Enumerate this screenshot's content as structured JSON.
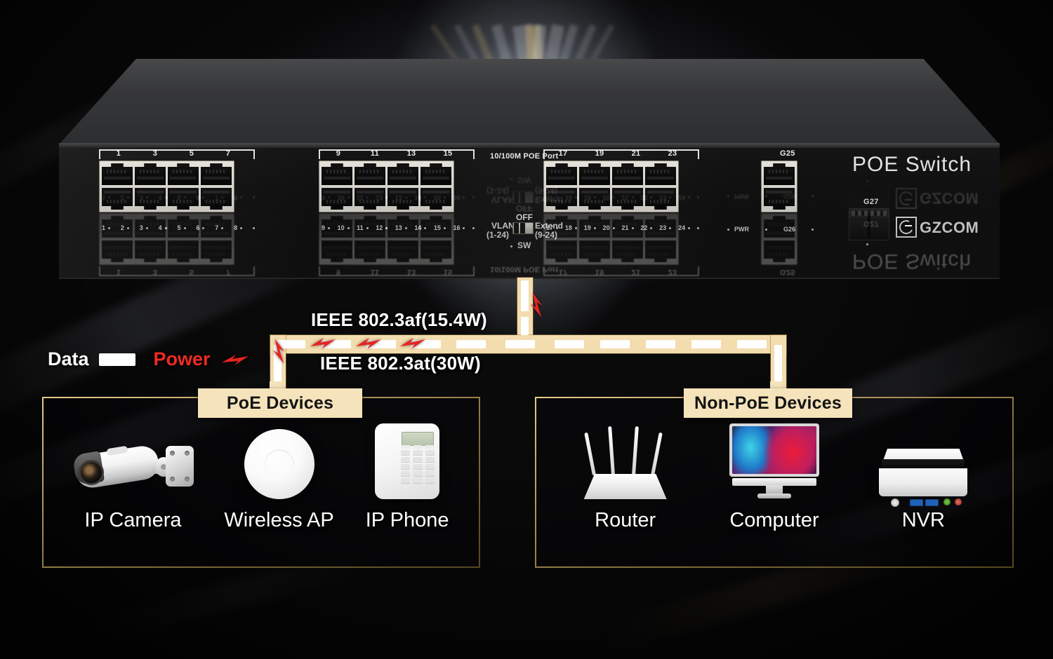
{
  "device": {
    "brand": "GZCOM",
    "model_label": "POE Switch",
    "port_group_label": "10/100M POE  Port",
    "port_groups": [
      {
        "bracket_numbers": [
          "1",
          "3",
          "5",
          "7"
        ],
        "led_labels": [
          "1",
          "2",
          "3",
          "4",
          "5",
          "6",
          "7",
          "8"
        ]
      },
      {
        "bracket_numbers": [
          "9",
          "11",
          "13",
          "15"
        ],
        "led_labels": [
          "9",
          "10",
          "11",
          "12",
          "13",
          "14",
          "15",
          "16"
        ]
      },
      {
        "bracket_numbers": [
          "17",
          "19",
          "21",
          "23"
        ],
        "led_labels": [
          "17",
          "18",
          "19",
          "20",
          "21",
          "22",
          "23",
          "24"
        ]
      }
    ],
    "uplink": {
      "top_label": "G25",
      "bottom_label": "G26",
      "sfp_label": "G27"
    },
    "power_led_label": "PWR",
    "dip_switch": {
      "left_line1": "VLAN",
      "left_line2": "(1-24)",
      "top_label": "OFF",
      "right_line1": "Extend",
      "right_line2": "(9-24)",
      "bottom_label": "SW"
    }
  },
  "legend": {
    "data_label": "Data",
    "power_label": "Power"
  },
  "standards": {
    "af": "IEEE 802.3af(15.4W)",
    "at": "IEEE 802.3at(30W)"
  },
  "panels": [
    {
      "tab_label": "PoE Devices",
      "devices": [
        {
          "name": "IP Camera",
          "icon": "ip-camera-icon"
        },
        {
          "name": "Wireless AP",
          "icon": "wireless-ap-icon"
        },
        {
          "name": "IP Phone",
          "icon": "ip-phone-icon"
        }
      ]
    },
    {
      "tab_label": "Non-PoE Devices",
      "devices": [
        {
          "name": "Router",
          "icon": "router-icon"
        },
        {
          "name": "Computer",
          "icon": "computer-icon"
        },
        {
          "name": "NVR",
          "icon": "nvr-icon"
        }
      ]
    }
  ],
  "colors": {
    "pipe": "#f3dcae",
    "tab_bg": "#f5e3bb",
    "power_red": "#ef2a24",
    "panel_border": "#c6a969",
    "data_white": "#ffffff"
  }
}
